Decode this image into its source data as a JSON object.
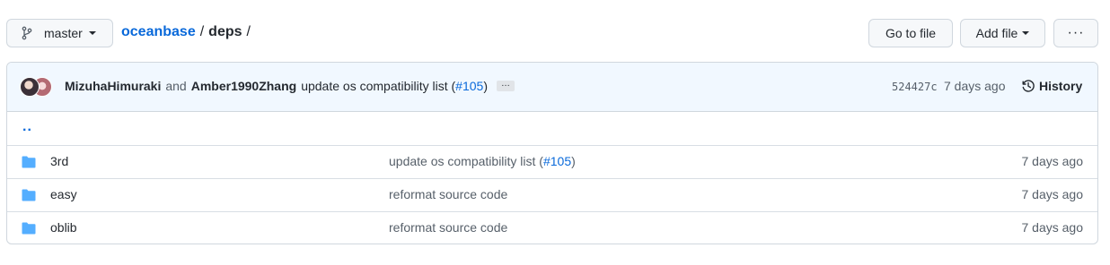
{
  "branch": {
    "name": "master"
  },
  "breadcrumb": {
    "repo": "oceanbase",
    "sep1": "/",
    "dir": "deps",
    "sep2": "/"
  },
  "actions": {
    "go_to_file": "Go to file",
    "add_file": "Add file",
    "more": "···"
  },
  "commit": {
    "author1": "MizuhaHimuraki",
    "and": "and",
    "author2": "Amber1990Zhang",
    "message": "update os compatibility list (",
    "pr": "#105",
    "message_end": ")",
    "ellipsis": "…",
    "sha": "524427c",
    "age": "7 days ago",
    "history_label": "History"
  },
  "parent_link": "..",
  "files": [
    {
      "name": "3rd",
      "message": "update os compatibility list (",
      "pr": "#105",
      "message_end": ")",
      "age": "7 days ago",
      "icon": "folder-icon"
    },
    {
      "name": "easy",
      "message": "reformat source code",
      "age": "7 days ago",
      "icon": "folder-icon"
    },
    {
      "name": "oblib",
      "message": "reformat source code",
      "age": "7 days ago",
      "icon": "folder-icon"
    }
  ],
  "colors": {
    "link": "#0969da",
    "folder": "#54aeff",
    "commit_bg": "#f1f8ff",
    "border": "#d0d7de"
  }
}
